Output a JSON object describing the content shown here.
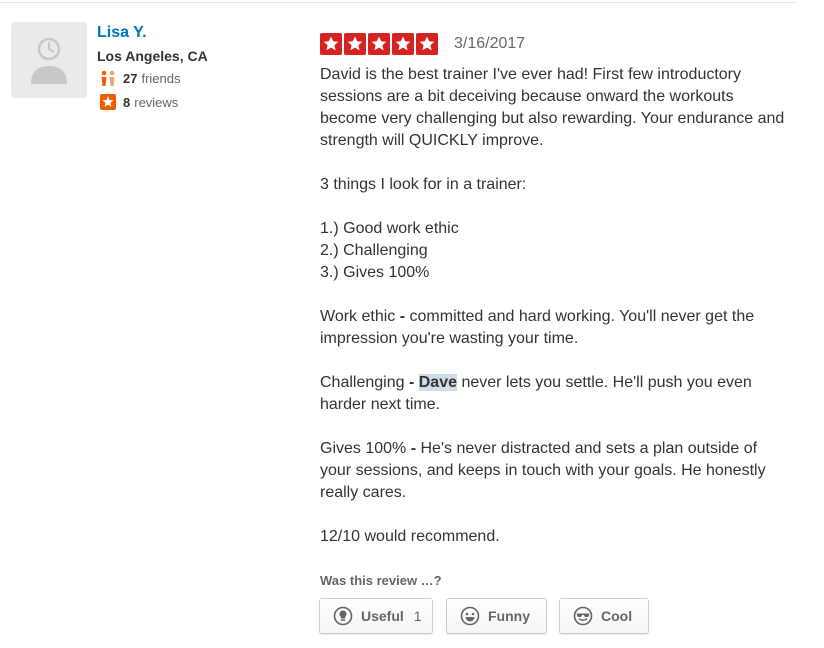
{
  "user": {
    "name": "Lisa Y.",
    "location": "Los Angeles, CA",
    "friends_count": "27",
    "friends_label": "friends",
    "reviews_count": "8",
    "reviews_label": "reviews"
  },
  "review": {
    "rating": 5,
    "max_rating": 5,
    "date": "3/16/2017",
    "p1": "David is the best trainer I've ever had! First few introductory sessions are a bit deceiving because onward the workouts become very challenging but also rewarding. Your endurance and strength will QUICKLY improve.",
    "p2": "3 things I look for in a trainer:",
    "list": [
      "1.) Good work ethic",
      "2.) Challenging",
      "3.) Gives 100%"
    ],
    "p3_label": "Work ethic",
    "p3_text": "committed and hard working. You'll never get the impression you're wasting your time.",
    "p4_label": "Challenging",
    "p4_highlight": "Dave",
    "p4_text": "never lets you settle. He'll push you even harder next time.",
    "p5_label": "Gives 100%",
    "p5_text": "He's never distracted and sets a plan outside of your sessions, and keeps in touch with your goals. He honestly really cares.",
    "p6": "12/10 would recommend.",
    "separator": "-"
  },
  "votes": {
    "prompt": "Was this review …?",
    "useful_label": "Useful",
    "useful_count": "1",
    "funny_label": "Funny",
    "cool_label": "Cool"
  },
  "colors": {
    "star_red": "#d32323",
    "link_blue": "#0073bb",
    "highlight": "#cfdde8"
  },
  "icons": {
    "avatar": "default-user-icon",
    "friends": "friends-icon",
    "reviews": "star-badge-icon",
    "useful": "lightbulb-icon",
    "funny": "smiley-icon",
    "cool": "sunglasses-icon"
  }
}
